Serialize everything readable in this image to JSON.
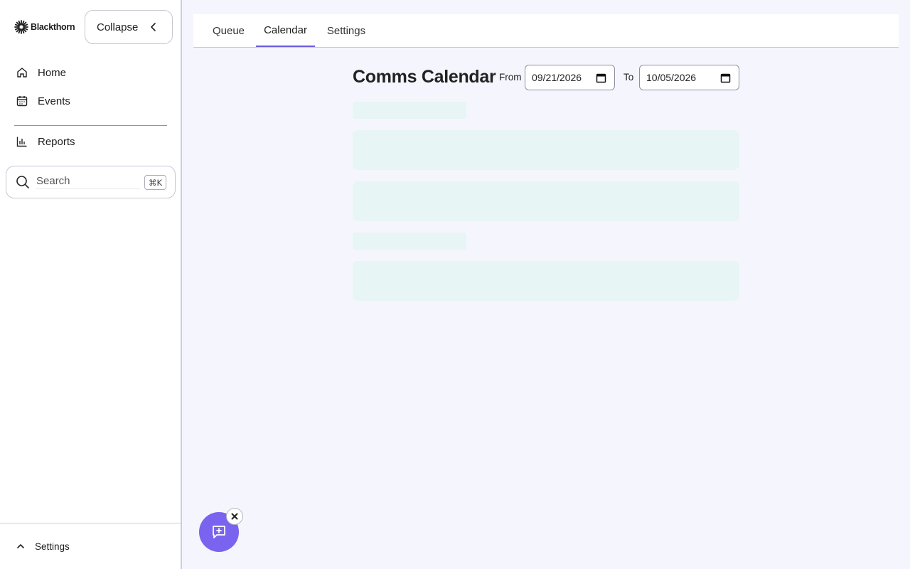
{
  "brand": {
    "name": "Blackthorn"
  },
  "sidebar": {
    "collapse_label": "Collapse",
    "nav": [
      {
        "label": "Home",
        "icon": "home-icon"
      },
      {
        "label": "Events",
        "icon": "calendar-icon"
      }
    ],
    "nav_secondary": [
      {
        "label": "Reports",
        "icon": "bar-chart-icon"
      }
    ],
    "search": {
      "placeholder": "Search",
      "shortcut": "⌘K"
    },
    "footer_label": "Settings"
  },
  "tabs": [
    {
      "label": "Queue",
      "active": false
    },
    {
      "label": "Calendar",
      "active": true
    },
    {
      "label": "Settings",
      "active": false
    }
  ],
  "page": {
    "title": "Comms Calendar",
    "from_label": "From",
    "from_value": "09/21/2026",
    "to_label": "To",
    "to_value": "10/05/2026"
  },
  "colors": {
    "accent": "#6b5ce0",
    "fab": "#7a63ee",
    "skeleton": "#e7f5f4",
    "background": "#f5f6fd"
  }
}
